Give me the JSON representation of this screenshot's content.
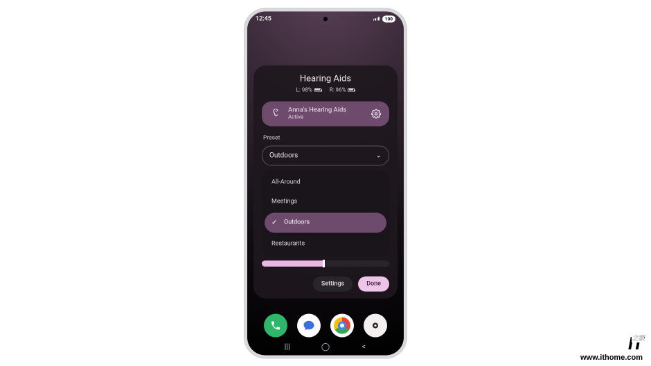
{
  "status": {
    "time": "12:45",
    "battery": "100"
  },
  "card": {
    "title": "Hearing Aids",
    "left_label": "L: 98%",
    "right_label": "R: 96%",
    "device": {
      "name": "Anna's Hearing Aids",
      "status": "Active"
    },
    "preset_label": "Preset",
    "preset_selected": "Outdoors",
    "options": {
      "a": "All-Around",
      "b": "Meetings",
      "c": "Outdoors",
      "d": "Restaurants"
    },
    "settings_label": "Settings",
    "done_label": "Done"
  },
  "watermark": {
    "logo": "IT",
    "url": "www.ithome.com",
    "zh": "之家"
  }
}
